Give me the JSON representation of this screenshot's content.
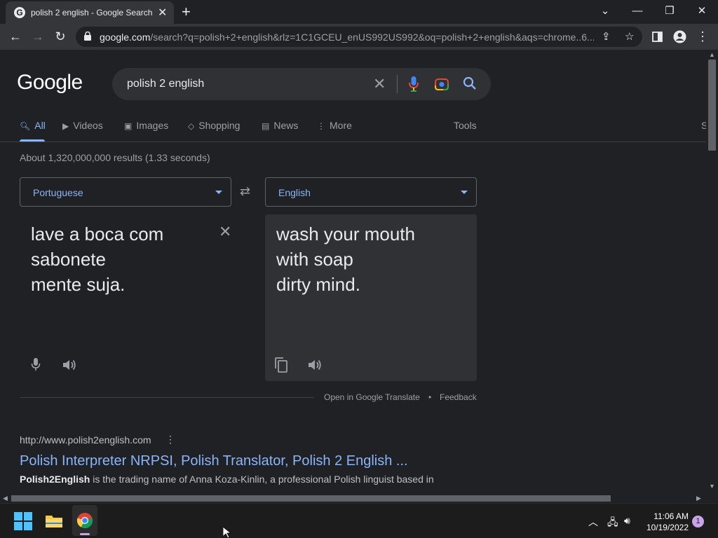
{
  "browser": {
    "tab_title": "polish 2 english - Google Search",
    "favicon_letter": "G",
    "url_domain": "google.com",
    "url_rest": "/search?q=polish+2+english&rlz=1C1GCEU_enUS992US992&oq=polish+2+english&aqs=chrome..6..."
  },
  "google": {
    "logo": "Google",
    "query": "polish 2 english",
    "tabs": [
      {
        "label": "All"
      },
      {
        "label": "Videos"
      },
      {
        "label": "Images"
      },
      {
        "label": "Shopping"
      },
      {
        "label": "News"
      },
      {
        "label": "More"
      }
    ],
    "tools_label": "Tools",
    "settings_partial": "S",
    "result_stats": "About 1,320,000,000 results (1.33 seconds)"
  },
  "translator": {
    "source_lang": "Portuguese",
    "target_lang": "English",
    "source_text": "lave a boca com\nsabonete\nmente suja.",
    "target_text": "wash your mouth\nwith soap\ndirty mind.",
    "open_link": "Open in Google Translate",
    "separator": "•",
    "feedback": "Feedback"
  },
  "result": {
    "url": "http://www.polish2english.com",
    "title": "Polish Interpreter NRPSI, Polish Translator, Polish 2 English ...",
    "snippet_bold": "Polish2English",
    "snippet_rest": " is the trading name of Anna Koza-Kinlin, a professional Polish linguist based in"
  },
  "taskbar": {
    "time": "11:06 AM",
    "date": "10/19/2022",
    "notifications": "1"
  },
  "colors": {
    "accent_blue": "#8ab4f8",
    "page_bg": "#202124",
    "box_bg": "#303134"
  }
}
